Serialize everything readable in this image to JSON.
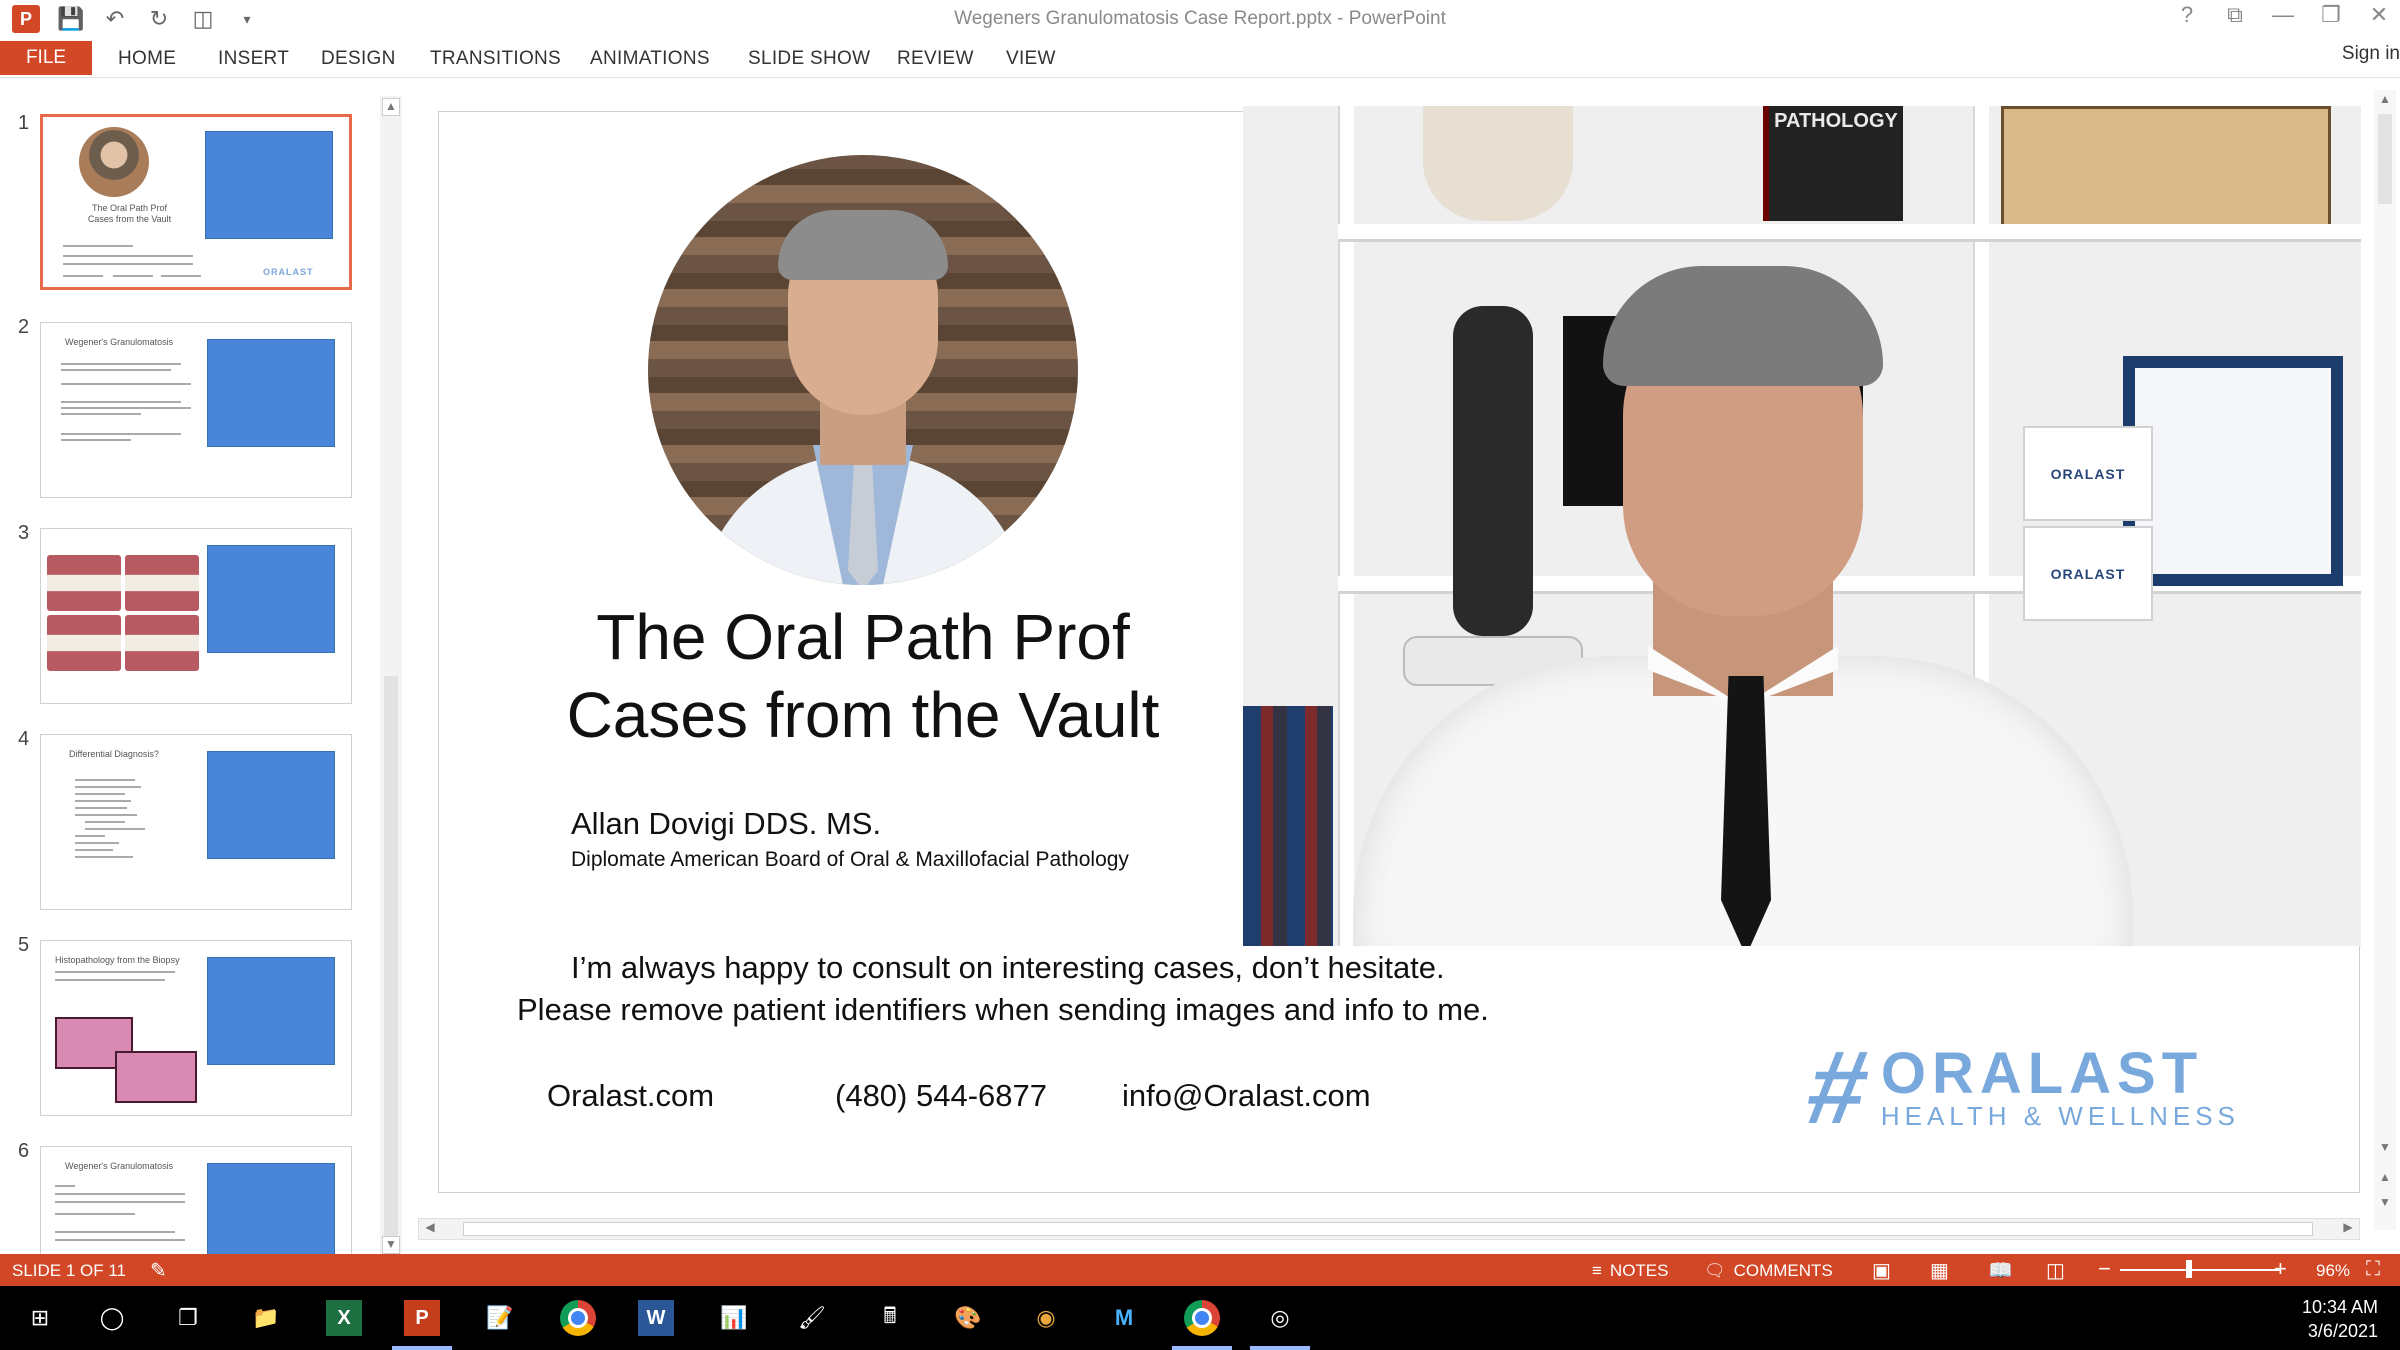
{
  "window": {
    "title": "Wegeners Granulomatosis  Case Report.pptx - PowerPoint",
    "app_logo": "P",
    "controls": [
      "?",
      "⧉",
      "—",
      "❐",
      "✕"
    ]
  },
  "ribbon": {
    "file_tab": "FILE",
    "tabs": [
      "HOME",
      "INSERT",
      "DESIGN",
      "TRANSITIONS",
      "ANIMATIONS",
      "SLIDE SHOW",
      "REVIEW",
      "VIEW"
    ],
    "sign_in": "Sign in",
    "accent": "#d24726"
  },
  "thumbnails": [
    {
      "number": "1",
      "selected": true,
      "title_l1": "The Oral Path Prof",
      "title_l2": "Cases from the Vault",
      "logo": "ORALAST"
    },
    {
      "number": "2",
      "selected": false,
      "heading": "Wegener's Granulomatosis"
    },
    {
      "number": "3",
      "selected": false
    },
    {
      "number": "4",
      "selected": false,
      "heading": "Differential Diagnosis?"
    },
    {
      "number": "5",
      "selected": false,
      "heading": "Histopathology from the Biopsy"
    },
    {
      "number": "6",
      "selected": false,
      "heading": "Wegener's Granulomatosis"
    }
  ],
  "slide": {
    "title_line1": "The Oral Path Prof",
    "title_line2": "Cases from the Vault",
    "presenter": "Allan Dovigi DDS. MS.",
    "credentials": "Diplomate American Board of Oral & Maxillofacial Pathology",
    "message_line1": "I’m always happy to consult on interesting cases, don’t hesitate.",
    "message_line2": "Please remove patient identifiers when sending images and info to me.",
    "website": "Oralast.com",
    "phone": "(480) 544-6877",
    "email": "info@Oralast.com",
    "logo_name": "ORALAST",
    "logo_sub": "HEALTH & WELLNESS",
    "logo_color": "#79a8dd"
  },
  "webcam": {
    "book_title": "PATHOLOGY",
    "box_label_1": "ORALAST",
    "box_label_2": "ORALAST"
  },
  "statusbar": {
    "slide_indicator": "SLIDE 1 OF 11",
    "notes": "NOTES",
    "comments": "COMMENTS",
    "zoom": "96%"
  },
  "taskbar": {
    "excel_label": "X",
    "ppt_label": "P",
    "word_label": "W",
    "time": "10:34 AM",
    "date": "3/6/2021"
  }
}
